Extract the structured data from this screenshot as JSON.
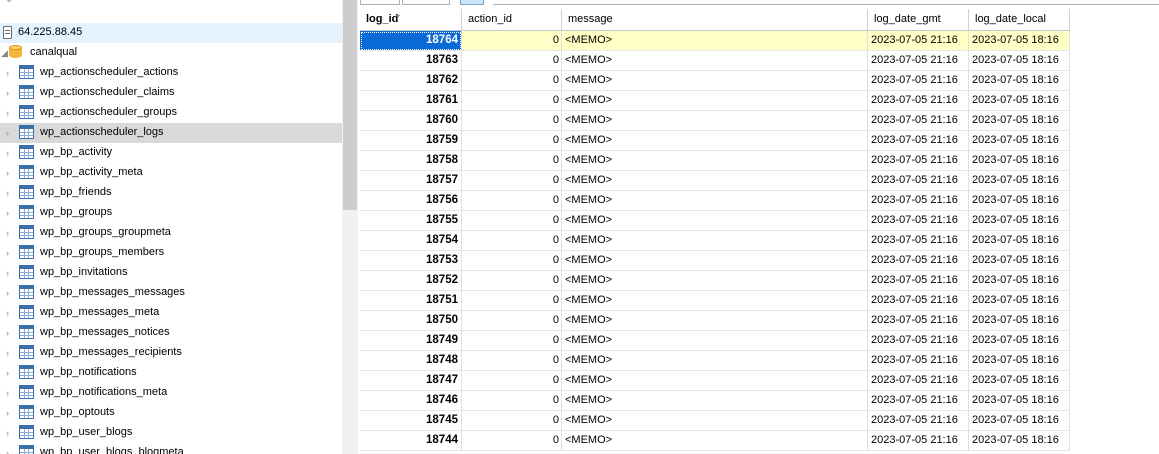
{
  "tree": {
    "server": {
      "label": "64.225.88.45"
    },
    "database": {
      "label": "canalqual"
    },
    "tables": [
      "wp_actionscheduler_actions",
      "wp_actionscheduler_claims",
      "wp_actionscheduler_groups",
      "wp_actionscheduler_logs",
      "wp_bp_activity",
      "wp_bp_activity_meta",
      "wp_bp_friends",
      "wp_bp_groups",
      "wp_bp_groups_groupmeta",
      "wp_bp_groups_members",
      "wp_bp_invitations",
      "wp_bp_messages_messages",
      "wp_bp_messages_meta",
      "wp_bp_messages_notices",
      "wp_bp_messages_recipients",
      "wp_bp_notifications",
      "wp_bp_notifications_meta",
      "wp_bp_optouts",
      "wp_bp_user_blogs",
      "wp_bp_user_blogs_blogmeta"
    ],
    "selected_table": "wp_actionscheduler_logs"
  },
  "grid": {
    "columns": [
      "log_id",
      "action_id",
      "message",
      "log_date_gmt",
      "log_date_local"
    ],
    "sorted_column": "log_id",
    "rows": [
      {
        "log_id": "18764",
        "action_id": "0",
        "message": "<MEMO>",
        "log_date_gmt": "2023-07-05 21:16",
        "log_date_local": "2023-07-05 18:16"
      },
      {
        "log_id": "18763",
        "action_id": "0",
        "message": "<MEMO>",
        "log_date_gmt": "2023-07-05 21:16",
        "log_date_local": "2023-07-05 18:16"
      },
      {
        "log_id": "18762",
        "action_id": "0",
        "message": "<MEMO>",
        "log_date_gmt": "2023-07-05 21:16",
        "log_date_local": "2023-07-05 18:16"
      },
      {
        "log_id": "18761",
        "action_id": "0",
        "message": "<MEMO>",
        "log_date_gmt": "2023-07-05 21:16",
        "log_date_local": "2023-07-05 18:16"
      },
      {
        "log_id": "18760",
        "action_id": "0",
        "message": "<MEMO>",
        "log_date_gmt": "2023-07-05 21:16",
        "log_date_local": "2023-07-05 18:16"
      },
      {
        "log_id": "18759",
        "action_id": "0",
        "message": "<MEMO>",
        "log_date_gmt": "2023-07-05 21:16",
        "log_date_local": "2023-07-05 18:16"
      },
      {
        "log_id": "18758",
        "action_id": "0",
        "message": "<MEMO>",
        "log_date_gmt": "2023-07-05 21:16",
        "log_date_local": "2023-07-05 18:16"
      },
      {
        "log_id": "18757",
        "action_id": "0",
        "message": "<MEMO>",
        "log_date_gmt": "2023-07-05 21:16",
        "log_date_local": "2023-07-05 18:16"
      },
      {
        "log_id": "18756",
        "action_id": "0",
        "message": "<MEMO>",
        "log_date_gmt": "2023-07-05 21:16",
        "log_date_local": "2023-07-05 18:16"
      },
      {
        "log_id": "18755",
        "action_id": "0",
        "message": "<MEMO>",
        "log_date_gmt": "2023-07-05 21:16",
        "log_date_local": "2023-07-05 18:16"
      },
      {
        "log_id": "18754",
        "action_id": "0",
        "message": "<MEMO>",
        "log_date_gmt": "2023-07-05 21:16",
        "log_date_local": "2023-07-05 18:16"
      },
      {
        "log_id": "18753",
        "action_id": "0",
        "message": "<MEMO>",
        "log_date_gmt": "2023-07-05 21:16",
        "log_date_local": "2023-07-05 18:16"
      },
      {
        "log_id": "18752",
        "action_id": "0",
        "message": "<MEMO>",
        "log_date_gmt": "2023-07-05 21:16",
        "log_date_local": "2023-07-05 18:16"
      },
      {
        "log_id": "18751",
        "action_id": "0",
        "message": "<MEMO>",
        "log_date_gmt": "2023-07-05 21:16",
        "log_date_local": "2023-07-05 18:16"
      },
      {
        "log_id": "18750",
        "action_id": "0",
        "message": "<MEMO>",
        "log_date_gmt": "2023-07-05 21:16",
        "log_date_local": "2023-07-05 18:16"
      },
      {
        "log_id": "18749",
        "action_id": "0",
        "message": "<MEMO>",
        "log_date_gmt": "2023-07-05 21:16",
        "log_date_local": "2023-07-05 18:16"
      },
      {
        "log_id": "18748",
        "action_id": "0",
        "message": "<MEMO>",
        "log_date_gmt": "2023-07-05 21:16",
        "log_date_local": "2023-07-05 18:16"
      },
      {
        "log_id": "18747",
        "action_id": "0",
        "message": "<MEMO>",
        "log_date_gmt": "2023-07-05 21:16",
        "log_date_local": "2023-07-05 18:16"
      },
      {
        "log_id": "18746",
        "action_id": "0",
        "message": "<MEMO>",
        "log_date_gmt": "2023-07-05 21:16",
        "log_date_local": "2023-07-05 18:16"
      },
      {
        "log_id": "18745",
        "action_id": "0",
        "message": "<MEMO>",
        "log_date_gmt": "2023-07-05 21:16",
        "log_date_local": "2023-07-05 18:16"
      },
      {
        "log_id": "18744",
        "action_id": "0",
        "message": "<MEMO>",
        "log_date_gmt": "2023-07-05 21:16",
        "log_date_local": "2023-07-05 18:16"
      }
    ]
  },
  "colors": {
    "selection": "#0a6bd6",
    "current_row": "#ffffc6",
    "tree_selected": "#d9d9d9",
    "server_highlight": "#e5f3ff"
  },
  "icons": {
    "server": "server-icon",
    "database": "database-icon",
    "table": "table-icon",
    "expand": "chevron-right-icon"
  }
}
